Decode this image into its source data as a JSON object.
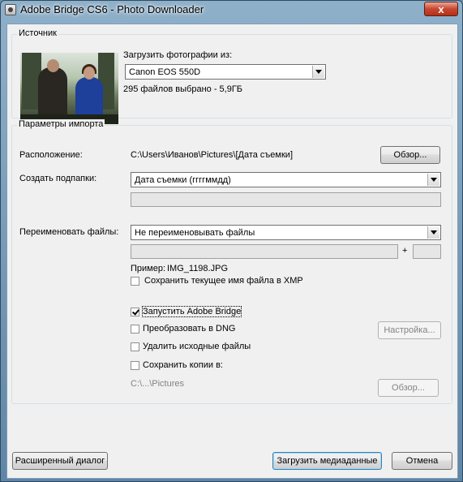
{
  "window": {
    "title": "Adobe Bridge CS6 - Photo Downloader",
    "close_glyph": "x"
  },
  "source": {
    "group_label": "Источник",
    "load_from_label": "Загрузить фотографии из:",
    "device_value": "Canon EOS 550D",
    "summary": "295 файлов выбрано - 5,9ГБ"
  },
  "import": {
    "group_label": "Параметры импорта",
    "location_label": "Расположение:",
    "location_value": "C:\\Users\\Иванов\\Pictures\\[Дата съемки]",
    "browse_label": "Обзор...",
    "subfolders_label": "Создать подпапки:",
    "subfolders_value": "Дата съемки (ггггммдд)",
    "rename_label": "Переименовать файлы:",
    "rename_value": "Не переименовывать файлы",
    "plus_label": "+",
    "example_label": "Пример:",
    "example_value": "IMG_1198.JPG",
    "keep_name_label": "Сохранить текущее имя файла в XMP",
    "launch_bridge_label": "Запустить Adobe Bridge",
    "convert_dng_label": "Преобразовать в DNG",
    "settings_label": "Настройка...",
    "delete_originals_label": "Удалить исходные файлы",
    "save_copies_label": "Сохранить копии в:",
    "copies_path": "C:\\...\\Pictures",
    "browse2_label": "Обзор..."
  },
  "checkboxes": {
    "keep_name": false,
    "launch_bridge": true,
    "convert_dng": false,
    "delete_originals": false,
    "save_copies": false
  },
  "footer": {
    "advanced_label": "Расширенный диалог",
    "download_label": "Загрузить медиаданные",
    "cancel_label": "Отмена"
  }
}
